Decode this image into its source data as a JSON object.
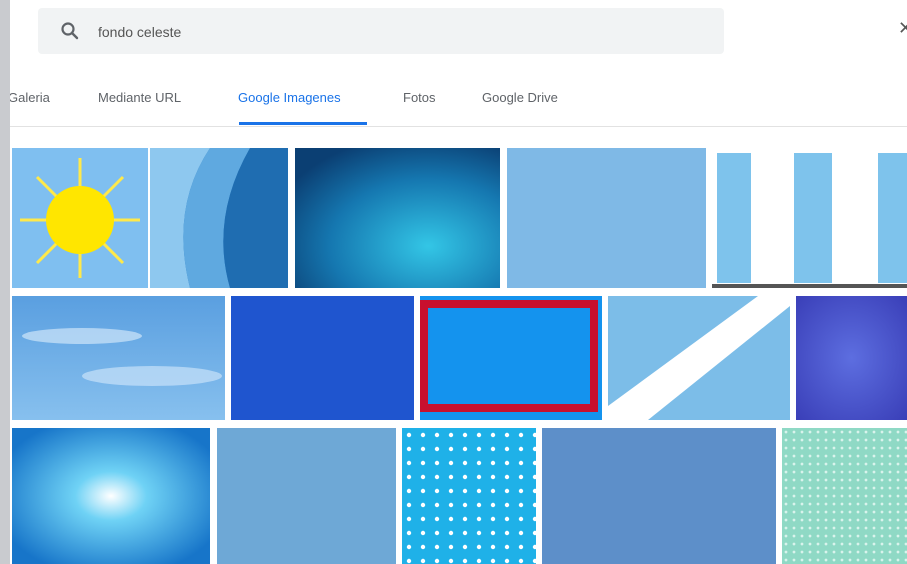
{
  "search": {
    "query": "fondo celeste",
    "icon": "search-icon",
    "close_icon": "close-icon"
  },
  "tabs": [
    {
      "label": "Galeria",
      "active": false
    },
    {
      "label": "Mediante URL",
      "active": false
    },
    {
      "label": "Google Imagenes",
      "active": true
    },
    {
      "label": "Fotos",
      "active": false
    },
    {
      "label": "Google Drive",
      "active": false
    }
  ],
  "colors": {
    "accent": "#1a73e8",
    "selection_border": "#c8102e"
  },
  "results": {
    "selected_index": 7,
    "images": [
      "sun-clipart",
      "blue-abstract-curves",
      "teal-watercolor",
      "plain-light-blue",
      "blue-white-stripes",
      "sky-with-clouds",
      "solid-royal-blue",
      "bright-blue-solid",
      "diagonal-white-band",
      "purple-blue-texture",
      "blue-bokeh-light",
      "blue-texture-grain",
      "polka-dot-blue",
      "steel-blue-solid",
      "mint-pattern"
    ]
  }
}
